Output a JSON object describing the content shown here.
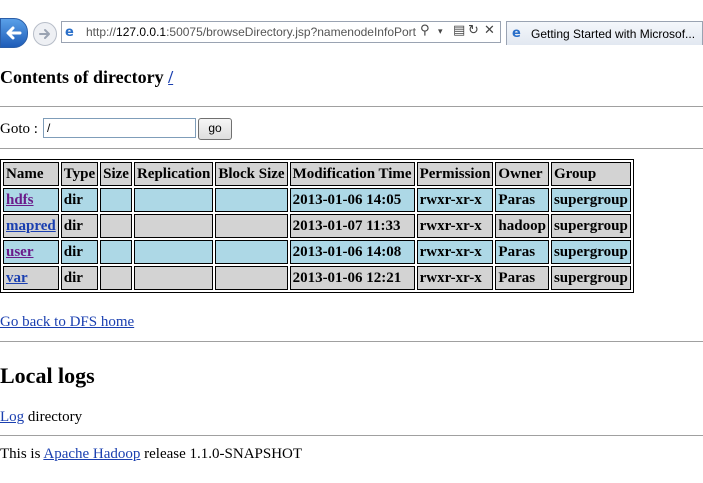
{
  "browser": {
    "url_prefix": "http://",
    "url_host": "127.0.0.1",
    "url_rest": ":50075/browseDirectory.jsp?namenodeInfoPort",
    "search_glyph": "⚲",
    "tab_title": "Getting Started with Microsof..."
  },
  "page": {
    "heading": "Contents of directory",
    "heading_link": "/",
    "goto_label": "Goto :",
    "goto_value": "/",
    "goto_button": "go",
    "table": {
      "headers": [
        "Name",
        "Type",
        "Size",
        "Replication",
        "Block Size",
        "Modification Time",
        "Permission",
        "Owner",
        "Group"
      ],
      "rows": [
        {
          "name": "hdfs",
          "type": "dir",
          "size": "",
          "replication": "",
          "block_size": "",
          "mtime": "2013-01-06 14:05",
          "permission": "rwxr-xr-x",
          "owner": "Paras",
          "group": "supergroup"
        },
        {
          "name": "mapred",
          "type": "dir",
          "size": "",
          "replication": "",
          "block_size": "",
          "mtime": "2013-01-07 11:33",
          "permission": "rwxr-xr-x",
          "owner": "hadoop",
          "group": "supergroup"
        },
        {
          "name": "user",
          "type": "dir",
          "size": "",
          "replication": "",
          "block_size": "",
          "mtime": "2013-01-06 14:08",
          "permission": "rwxr-xr-x",
          "owner": "Paras",
          "group": "supergroup"
        },
        {
          "name": "var",
          "type": "dir",
          "size": "",
          "replication": "",
          "block_size": "",
          "mtime": "2013-01-06 12:21",
          "permission": "rwxr-xr-x",
          "owner": "Paras",
          "group": "supergroup"
        }
      ]
    },
    "back_link": "Go back to DFS home",
    "local_logs_heading": "Local logs",
    "log_link": "Log",
    "log_suffix": " directory",
    "release_prefix": "This is ",
    "release_link": "Apache Hadoop",
    "release_suffix": " release 1.1.0-SNAPSHOT"
  },
  "colors": {
    "row_alt": "#add8e6",
    "row_plain": "#d3d3d3",
    "link": "#1a3fb0",
    "visited": "#6a1b8a"
  },
  "icons": [
    "back-arrow-icon",
    "forward-arrow-icon",
    "ie-logo-icon",
    "search-icon",
    "compat-view-icon",
    "refresh-icon",
    "stop-icon"
  ]
}
